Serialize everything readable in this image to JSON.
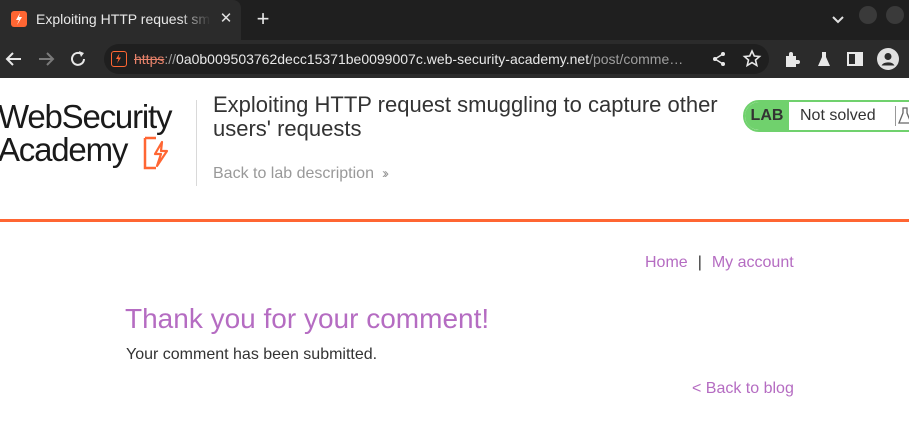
{
  "browser": {
    "tab": {
      "title": "Exploiting HTTP request smuggling to capture other users' requests"
    },
    "url": {
      "scheme": "https",
      "separator": "://",
      "host": "0a0b009503762decc15371be0099007c.web-security-academy.net",
      "path": "/post/comme…"
    }
  },
  "header": {
    "logo_line1": "WebSecurity",
    "logo_line2": "Academy",
    "lab_title": "Exploiting HTTP request smuggling to capture other users' requests",
    "back_to_description": "Back to lab description",
    "lab_label": "LAB",
    "lab_status": "Not solved"
  },
  "nav": {
    "home": "Home",
    "separator": "|",
    "my_account": "My account"
  },
  "content": {
    "title": "Thank you for your comment!",
    "message": "Your comment has been submitted.",
    "back_to_blog": "< Back to blog"
  },
  "colors": {
    "accent": "#ff6633",
    "link": "#b56cc2",
    "lab_green": "#70d16d"
  }
}
